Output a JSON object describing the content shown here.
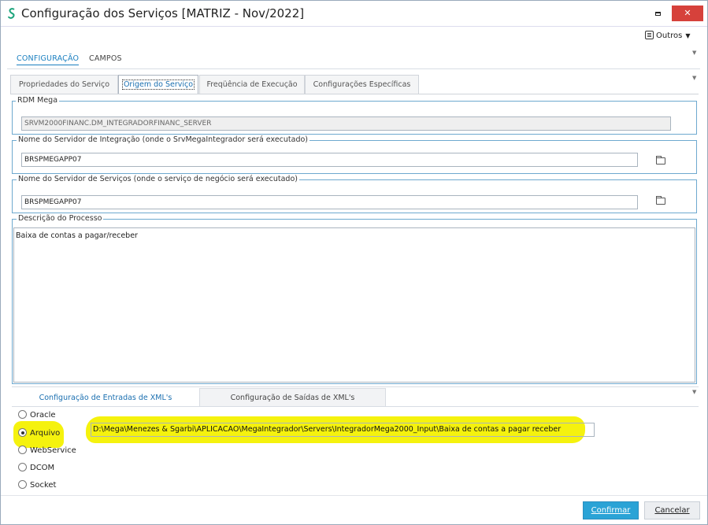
{
  "window": {
    "title": "Configuração dos Serviços [MATRIZ - Nov/2022]",
    "app_icon": "s-logo-icon",
    "close_glyph": "✕"
  },
  "toolbar": {
    "outros_label": "Outros"
  },
  "top_tabs": [
    {
      "label": "CONFIGURAÇÃO",
      "active": true
    },
    {
      "label": "CAMPOS",
      "active": false
    }
  ],
  "sub_tabs": [
    {
      "label": "Propriedades do Serviço",
      "active": false
    },
    {
      "label": "Origem do Serviço",
      "active": true
    },
    {
      "label": "Freqüência de Execução",
      "active": false
    },
    {
      "label": "Configurações Específicas",
      "active": false
    }
  ],
  "rdm": {
    "legend": "RDM Mega",
    "value": "SRVM2000FINANC.DM_INTEGRADORFINANC_SERVER"
  },
  "integration_server": {
    "legend": "Nome do Servidor de Integração  (onde o SrvMegaIntegrador será executado)",
    "value": "BRSPMEGAPP07"
  },
  "services_server": {
    "legend": "Nome do Servidor de Serviços (onde o serviço de negócio será executado)",
    "value": "BRSPMEGAPP07"
  },
  "process": {
    "legend": "Descrição do Processo",
    "value": "Baixa de contas a pagar/receber"
  },
  "xml_tabs": [
    {
      "label": "Configuração de Entradas de XML's",
      "active": true
    },
    {
      "label": "Configuração de Saídas de XML's",
      "active": false
    }
  ],
  "source_options": [
    {
      "label": "Oracle",
      "checked": false
    },
    {
      "label": "Arquivo",
      "checked": true
    },
    {
      "label": "WebService",
      "checked": false
    },
    {
      "label": "DCOM",
      "checked": false
    },
    {
      "label": "Socket",
      "checked": false
    }
  ],
  "file_path": "D:\\Mega\\Menezes & Sgarbi\\APLICACAO\\MegaIntegrador\\Servers\\IntegradorMega2000_Input\\Baixa de contas a pagar receber",
  "footer": {
    "confirm_label": "Confirmar",
    "cancel_label": "Cancelar"
  },
  "colors": {
    "accent": "#1a7fc0",
    "close_button": "#d6413b",
    "confirm_button": "#2aa3d6",
    "highlight": "#f5f20e",
    "group_border": "#6ea9cf"
  }
}
